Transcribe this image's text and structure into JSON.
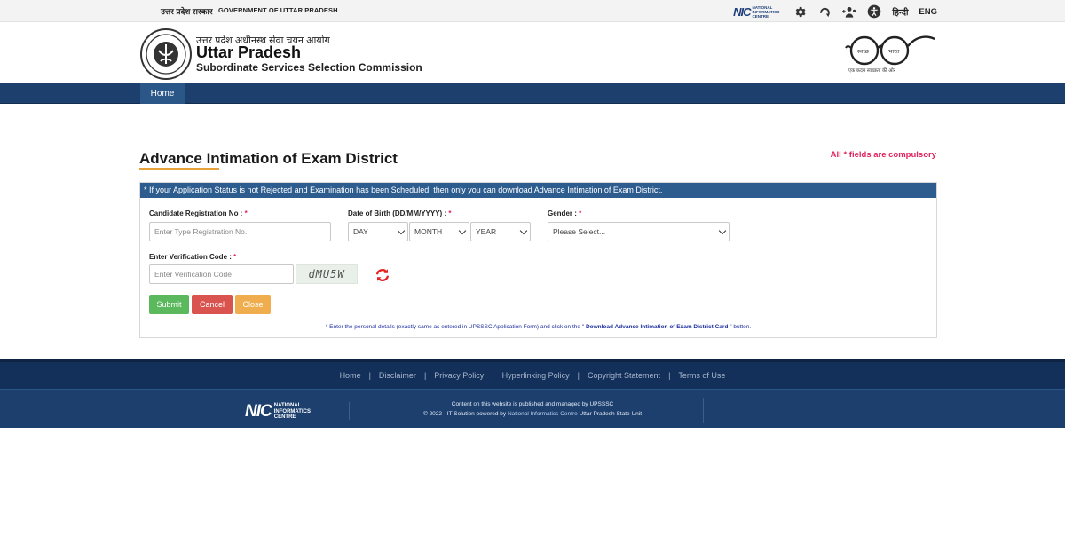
{
  "topbar": {
    "hindi_gov": "उत्तर प्रदेश सरकार",
    "english_gov": "GOVERNMENT OF UTTAR PRADESH",
    "nic_text": "NATIONAL INFORMATICS CENTRE",
    "lang_hindi": "हिन्दी",
    "lang_eng": "ENG"
  },
  "header": {
    "org_hindi": "उत्तर प्रदेश अधीनस्थ सेवा चयन आयोग",
    "org_name": "Uttar Pradesh",
    "org_sub": "Subordinate Services Selection Commission",
    "swachh_left": "स्वच्छ",
    "swachh_right": "भारत",
    "swachh_tag": "एक कदम स्वच्छता की ओर"
  },
  "nav": {
    "home": "Home"
  },
  "main": {
    "title": "Advance Intimation of Exam District",
    "compulsory": "All * fields are compulsory",
    "panel_note": "* If your Application Status is not Rejected and Examination has been Scheduled, then only you can download Advance Intimation of Exam District.",
    "reg_label": "Candidate Registration No : ",
    "reg_placeholder": "Enter Type Registration No.",
    "dob_label": "Date of Birth (DD/MM/YYYY) : ",
    "dob_day": "DAY",
    "dob_month": "MONTH",
    "dob_year": "YEAR",
    "gender_label": "Gender : ",
    "gender_value": "Please Select...",
    "verify_label": "Enter Verification Code : ",
    "verify_placeholder": "Enter Verification Code",
    "captcha": "dMU5W",
    "star": "*",
    "submit": "Submit",
    "cancel": "Cancel",
    "close": "Close",
    "footnote_pre": "* Enter the personal details (exactly same as entered in UPSSSC Application Form) and click on the \" ",
    "footnote_bold": "Download Advance Intimation of Exam District Card",
    "footnote_post": " \" button."
  },
  "footer": {
    "links": [
      "Home",
      "Disclaimer",
      "Privacy Policy",
      "Hyperlinking Policy",
      "Copyright Statement",
      "Terms of Use"
    ],
    "separator": "|",
    "nic_text": "NATIONAL INFORMATICS CENTRE",
    "line1": "Content on this website is published and managed by UPSSSC",
    "line2_pre": "© 2022 - IT Solution powered by ",
    "line2_hl": "National Informatics Centre",
    "line2_post": " Uttar Pradesh State Unit"
  },
  "colors": {
    "nav_bg": "#1c3f6e",
    "panel_head": "#2d5d8f",
    "accent_red": "#e0245e",
    "underline": "#e5a23b",
    "submit": "#5cb85c",
    "cancel": "#d9534f",
    "close": "#f0ad4e"
  },
  "icons": [
    "settings-icon",
    "screen-reader-icon",
    "sitemap-icon",
    "accessibility-icon",
    "refresh-icon"
  ]
}
